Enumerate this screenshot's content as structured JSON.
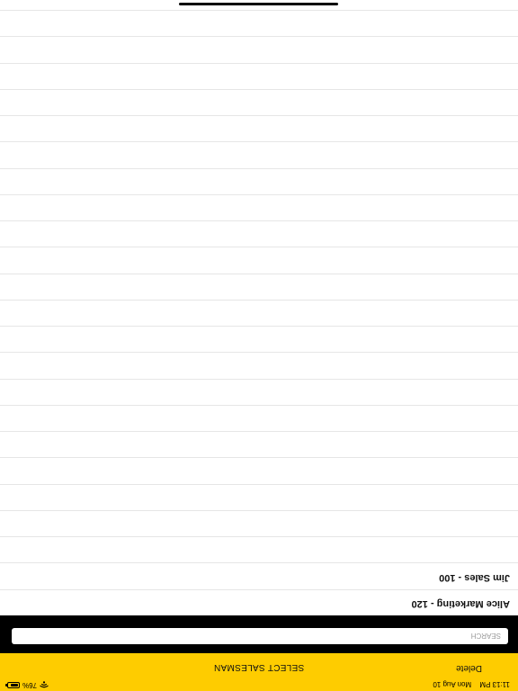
{
  "status_bar": {
    "time": "11:13 PM",
    "date": "Mon Aug 10",
    "battery_percent": "76%",
    "battery_level": 0.76
  },
  "nav": {
    "delete_label": "Delete",
    "title": "SELECT SALESMAN"
  },
  "search": {
    "placeholder": "SEARCH",
    "value": ""
  },
  "salesmen": [
    {
      "label": "Alice Marketing - 120"
    },
    {
      "label": "Jim Sales - 100"
    },
    {
      "label": ""
    },
    {
      "label": ""
    },
    {
      "label": ""
    },
    {
      "label": ""
    },
    {
      "label": ""
    },
    {
      "label": ""
    },
    {
      "label": ""
    },
    {
      "label": ""
    },
    {
      "label": ""
    },
    {
      "label": ""
    },
    {
      "label": ""
    },
    {
      "label": ""
    },
    {
      "label": ""
    },
    {
      "label": ""
    },
    {
      "label": ""
    },
    {
      "label": ""
    },
    {
      "label": ""
    },
    {
      "label": ""
    },
    {
      "label": ""
    },
    {
      "label": ""
    },
    {
      "label": ""
    },
    {
      "label": ""
    }
  ],
  "colors": {
    "accent": "#fecc00",
    "search_background": "#000000"
  }
}
